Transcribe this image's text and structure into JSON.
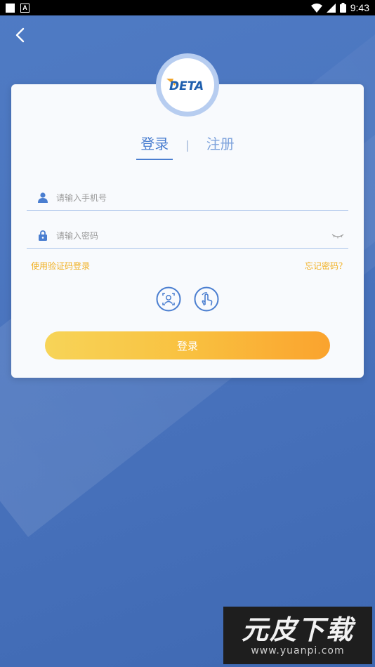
{
  "status_bar": {
    "time": "9:43"
  },
  "header": {
    "back_icon": "chevron-left-icon"
  },
  "logo": {
    "text": "DETA"
  },
  "tabs": [
    {
      "label": "登录",
      "active": true
    },
    {
      "label": "注册",
      "active": false
    }
  ],
  "tab_separator": "|",
  "form": {
    "phone": {
      "placeholder": "请输入手机号",
      "value": "",
      "icon": "user-icon"
    },
    "password": {
      "placeholder": "请输入密码",
      "value": "",
      "icon": "lock-icon",
      "toggle_icon": "eye-closed-icon"
    }
  },
  "links": {
    "sms_login": "使用验证码登录",
    "forgot_password": "忘记密码？"
  },
  "biometrics": [
    {
      "icon": "face-id-icon"
    },
    {
      "icon": "fingerprint-touch-icon"
    }
  ],
  "submit_label": "登录",
  "watermark": {
    "title": "元皮下载",
    "url": "www.yuanpi.com"
  },
  "colors": {
    "background": "#4a74be",
    "accent": "#4a7ed0",
    "link": "#f1b022",
    "button_start": "#f7d458",
    "button_end": "#faa32e"
  }
}
